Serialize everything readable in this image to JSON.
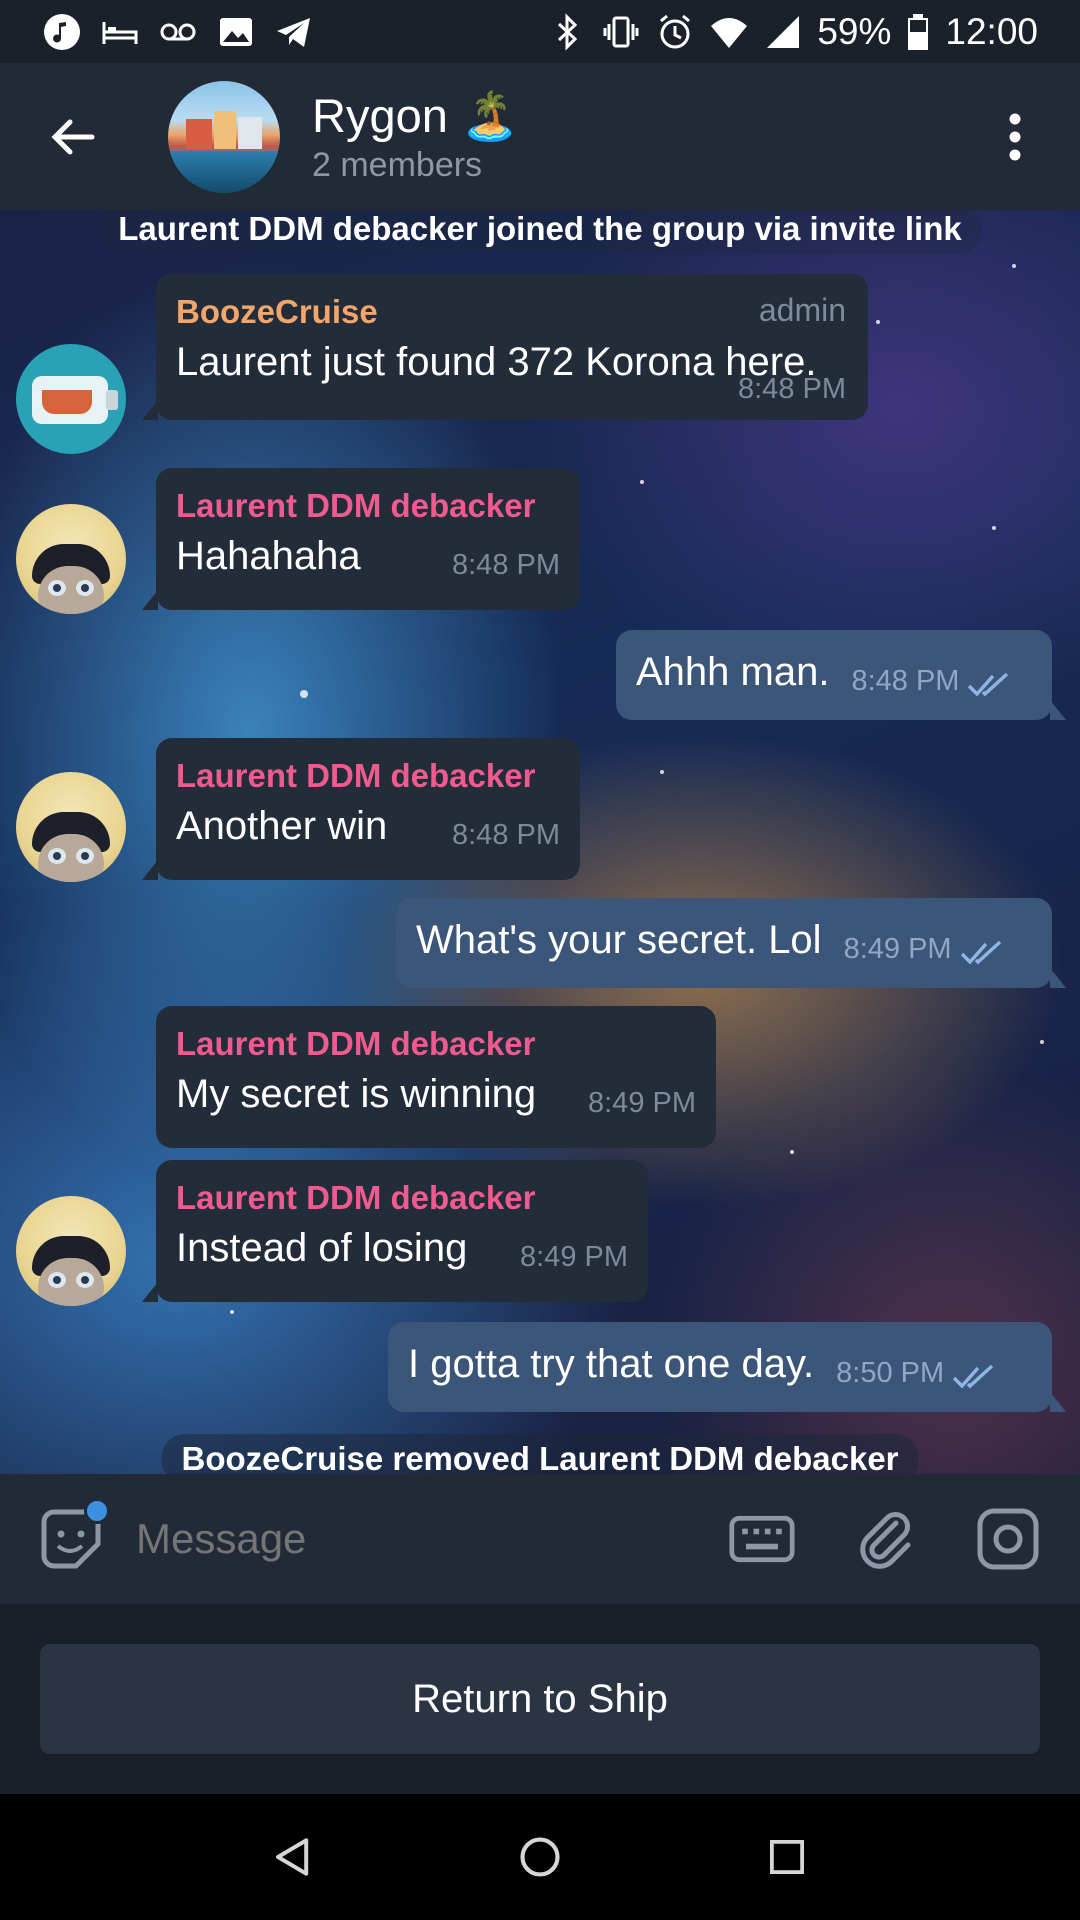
{
  "status_bar": {
    "battery": "59%",
    "time": "12:00"
  },
  "header": {
    "title": "Rygon 🏝️",
    "subtitle": "2 members"
  },
  "chat": {
    "service_join": "Laurent DDM debacker joined the group via invite link",
    "messages": [
      {
        "sender": "BoozeCruise",
        "badge": "admin",
        "text": "Laurent just found 372 Korona here.",
        "time": "8:48 PM"
      },
      {
        "sender": "Laurent DDM debacker",
        "text": "Hahahaha",
        "time": "8:48 PM"
      },
      {
        "text": "Ahhh man.",
        "time": "8:48 PM"
      },
      {
        "sender": "Laurent DDM debacker",
        "text": "Another win",
        "time": "8:48 PM"
      },
      {
        "text": "What's your secret. Lol",
        "time": "8:49 PM"
      },
      {
        "sender": "Laurent DDM debacker",
        "text": "My secret is winning",
        "time": "8:49 PM"
      },
      {
        "sender": "Laurent DDM debacker",
        "text": "Instead of losing",
        "time": "8:49 PM"
      },
      {
        "text": "I gotta try that one day.",
        "time": "8:50 PM"
      }
    ],
    "service_removed": "BoozeCruise removed Laurent DDM debacker"
  },
  "input": {
    "placeholder": "Message"
  },
  "bot_keyboard": {
    "button_label": "Return to Ship"
  },
  "colors": {
    "incoming_bubble": "#232c39",
    "outgoing_bubble": "#3c5679",
    "admin_name": "#f3a66b",
    "member_name": "#ef5b8f",
    "accent": "#3d8fe0"
  }
}
